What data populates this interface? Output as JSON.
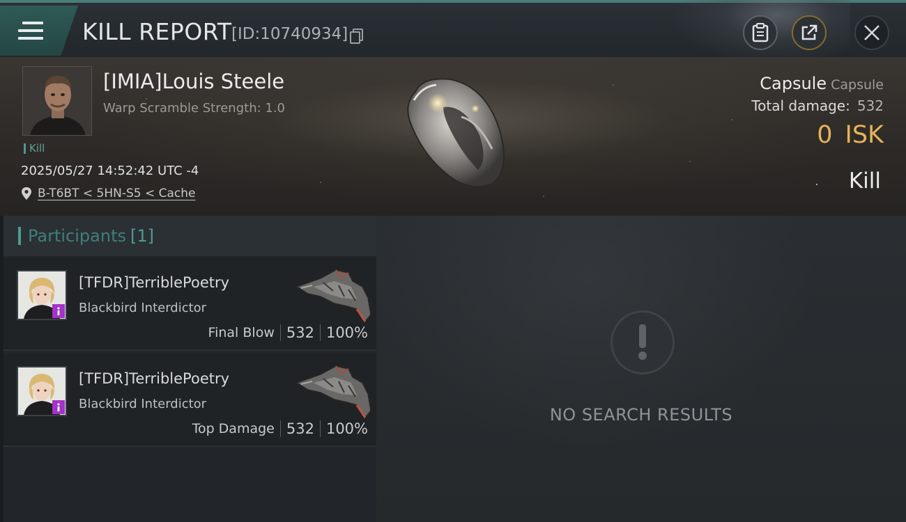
{
  "header": {
    "title": "KILL REPORT",
    "report_id": "[ID:10740934]"
  },
  "victim": {
    "name": "[IMIA]Louis Steele",
    "warp_scramble": "Warp Scramble Strength: 1.0",
    "kill_tag": "Kill",
    "timestamp": "2025/05/27 14:52:42 UTC -4",
    "location": "B-T6BT < 5HN-S5 < Cache",
    "ship_name": "Capsule",
    "ship_class": "Capsule",
    "total_damage_label": "Total damage:",
    "total_damage_value": "532",
    "isk_value": "0",
    "isk_currency": "ISK",
    "outcome": "Kill"
  },
  "participants": {
    "label": "Participants",
    "count": "[1]",
    "rows": [
      {
        "name": "[TFDR]TerriblePoetry",
        "ship": "Blackbird Interdictor",
        "role": "Final Blow",
        "damage": "532",
        "percent": "100%"
      },
      {
        "name": "[TFDR]TerriblePoetry",
        "ship": "Blackbird Interdictor",
        "role": "Top Damage",
        "damage": "532",
        "percent": "100%"
      }
    ]
  },
  "empty_state": {
    "text": "NO SEARCH RESULTS"
  },
  "icons": {
    "menu": "hamburger-menu-icon",
    "copy": "copy-icon",
    "clipboard": "clipboard-icon",
    "share": "share-icon",
    "close": "close-icon",
    "location": "location-pin-icon",
    "empty": "exclamation-icon"
  },
  "colors": {
    "accent_teal": "#4f9b92",
    "isk_gold": "#e8b25a",
    "badge_purple": "#a433c9",
    "share_ring": "#8a6a2c"
  }
}
